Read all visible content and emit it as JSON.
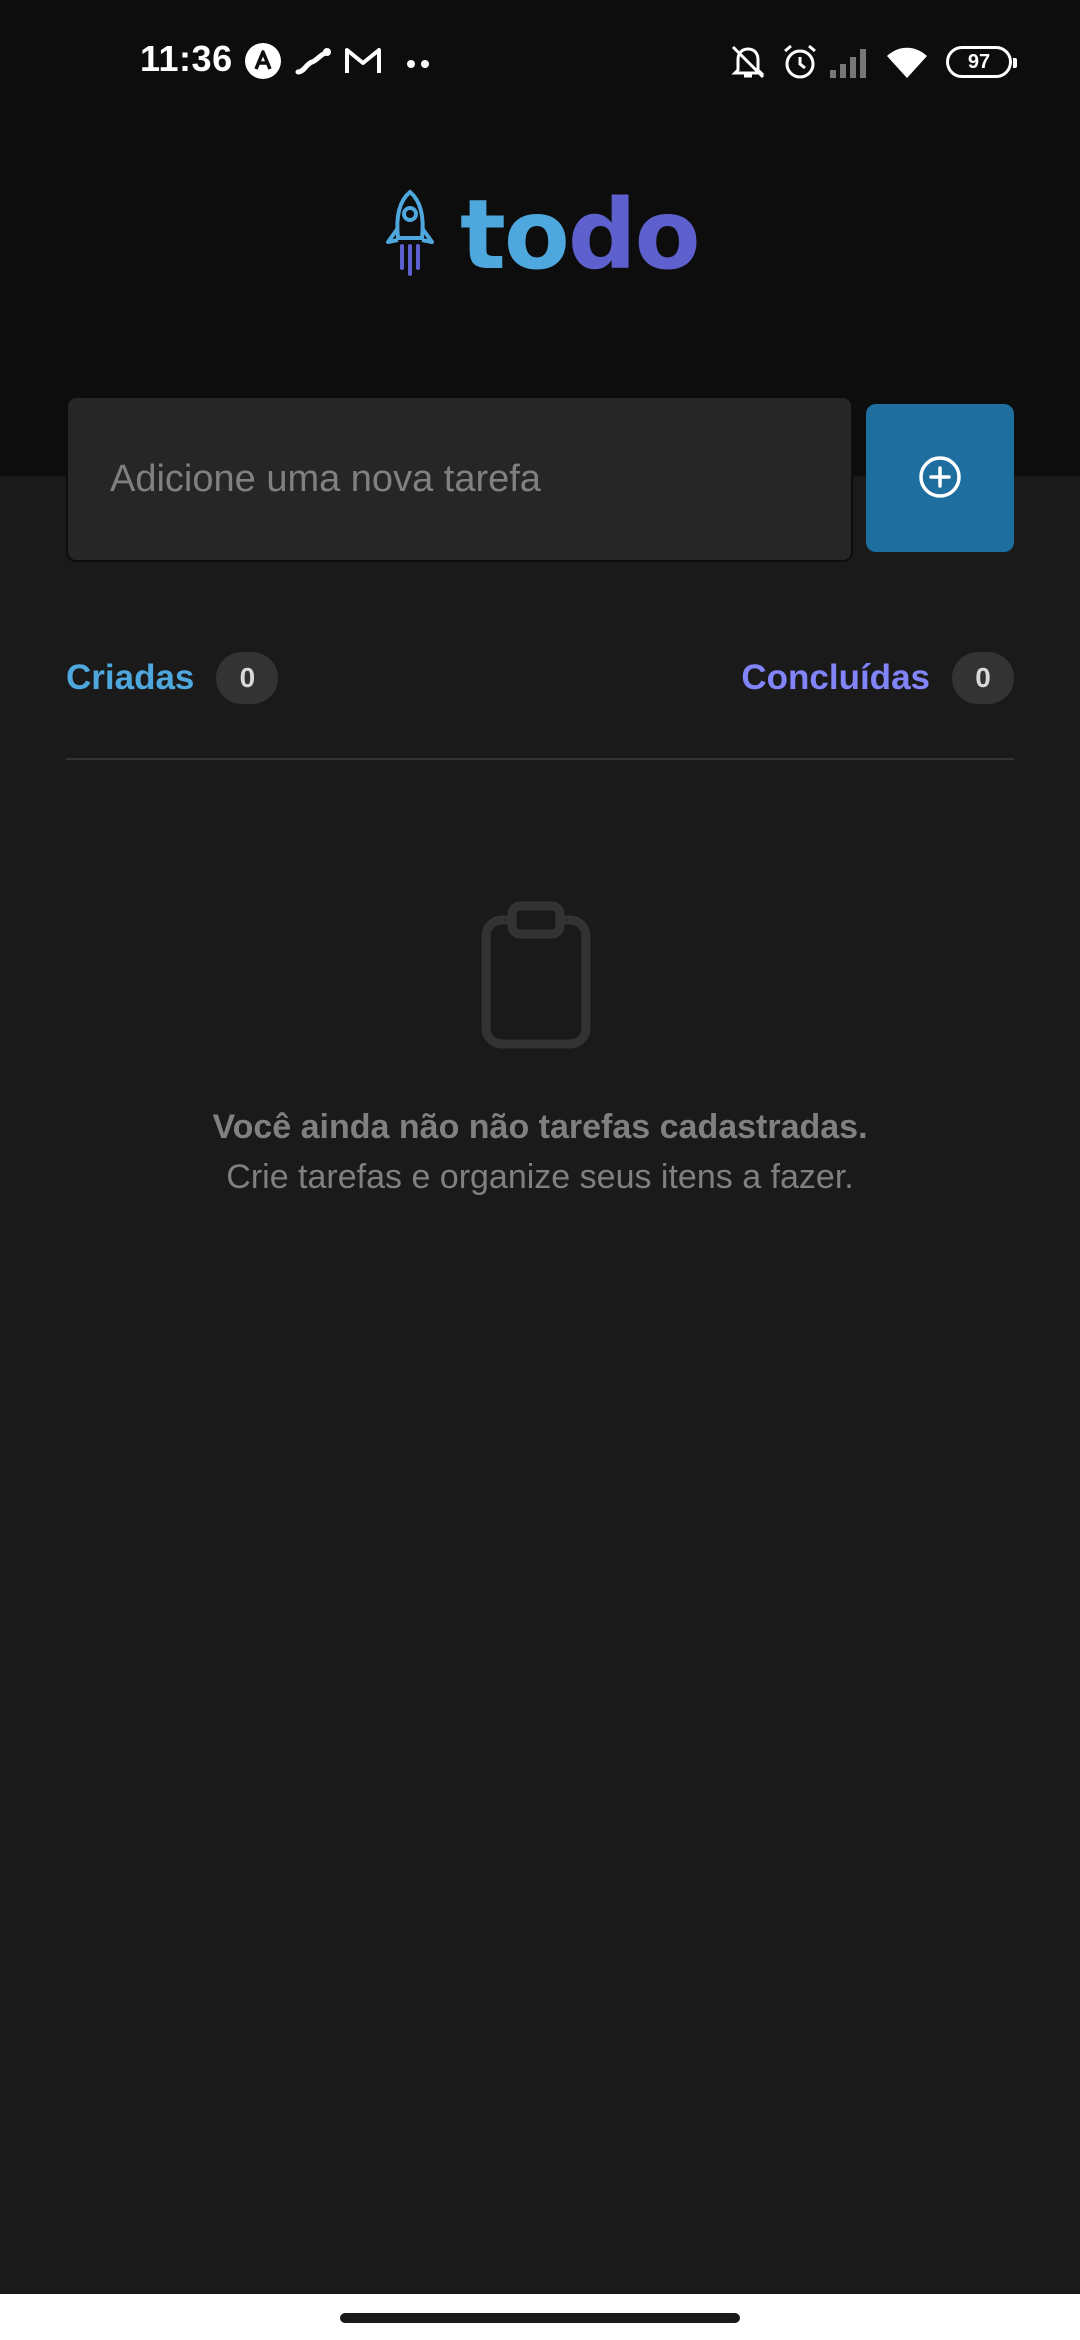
{
  "status_bar": {
    "time": "11:36",
    "battery": "97",
    "icons": [
      "a-badge-icon",
      "link-icon",
      "gmail-icon",
      "more-dots-icon",
      "notifications-off-icon",
      "alarm-icon",
      "signal-icon",
      "wifi-icon",
      "battery-icon"
    ]
  },
  "header": {
    "logo_part1": "to",
    "logo_part2": "do",
    "logo_icon": "rocket-icon"
  },
  "new_task": {
    "placeholder": "Adicione uma nova tarefa",
    "button_icon": "plus-circle-icon"
  },
  "counters": {
    "created_label": "Criadas",
    "created_count": "0",
    "done_label": "Concluídas",
    "done_count": "0"
  },
  "empty_state": {
    "icon": "clipboard-icon",
    "title": "Você ainda não não tarefas cadastradas.",
    "subtitle": "Crie tarefas e organize seus itens a fazer."
  },
  "colors": {
    "header_bg": "#0d0d0d",
    "page_bg": "#1a1a1a",
    "blue": "#4ea8de",
    "blue_dark": "#1e6f9f",
    "purple": "#5e60ce",
    "gray_text": "#808080"
  }
}
